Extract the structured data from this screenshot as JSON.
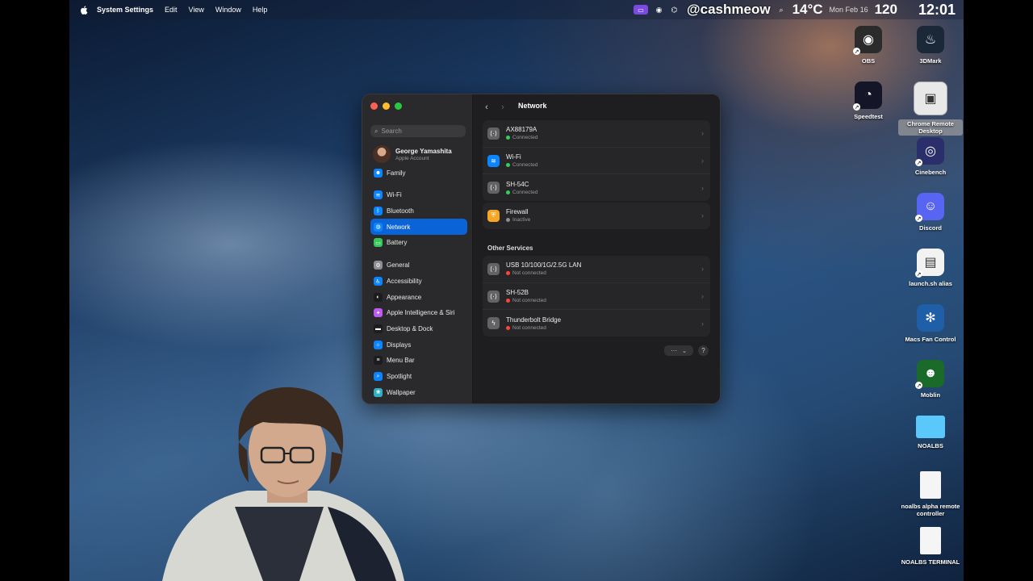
{
  "menubar": {
    "app_name": "System Settings",
    "menus": [
      "Edit",
      "View",
      "Window",
      "Help"
    ],
    "status": {
      "handle": "@cashmeow",
      "temperature": "14°C",
      "date": "Mon Feb 16",
      "overlay_number": "120",
      "clock": "12:01"
    }
  },
  "sidebar": {
    "search_placeholder": "Search",
    "account_name": "George Yamashita",
    "account_sub": "Apple Account",
    "family_label": "Family",
    "group1": [
      {
        "label": "Wi-Fi",
        "icon": "wifi-icon",
        "color": "#0a84ff",
        "glyph": "≋"
      },
      {
        "label": "Bluetooth",
        "icon": "bluetooth-icon",
        "color": "#0a84ff",
        "glyph": "ᛒ"
      },
      {
        "label": "Network",
        "icon": "globe-icon",
        "color": "#0a84ff",
        "glyph": "◍",
        "active": true
      },
      {
        "label": "Battery",
        "icon": "battery-icon",
        "color": "#34c759",
        "glyph": "▭"
      }
    ],
    "group2": [
      {
        "label": "General",
        "icon": "gear-icon",
        "color": "#8e8e93",
        "glyph": "⚙"
      },
      {
        "label": "Accessibility",
        "icon": "accessibility-icon",
        "color": "#0a84ff",
        "glyph": "♿"
      },
      {
        "label": "Appearance",
        "icon": "appearance-icon",
        "color": "#1c1c1e",
        "glyph": "◐"
      },
      {
        "label": "Apple Intelligence & Siri",
        "icon": "siri-icon",
        "color": "#bf5af2",
        "glyph": "✦"
      },
      {
        "label": "Desktop & Dock",
        "icon": "dock-icon",
        "color": "#1c1c1e",
        "glyph": "▬"
      },
      {
        "label": "Displays",
        "icon": "display-icon",
        "color": "#0a84ff",
        "glyph": "☼"
      },
      {
        "label": "Menu Bar",
        "icon": "menubar-icon",
        "color": "#1c1c1e",
        "glyph": "≡"
      },
      {
        "label": "Spotlight",
        "icon": "spotlight-icon",
        "color": "#0a84ff",
        "glyph": "⌕"
      },
      {
        "label": "Wallpaper",
        "icon": "wallpaper-icon",
        "color": "#30b0c7",
        "glyph": "❀"
      }
    ]
  },
  "main": {
    "title": "Network",
    "services": [
      {
        "name": "AX88179A",
        "status": "Connected",
        "status_color": "#30d158",
        "icon": "ethernet-icon",
        "icon_color": "#636366",
        "glyph": "⟨·⟩"
      },
      {
        "name": "Wi-Fi",
        "status": "Connected",
        "status_color": "#30d158",
        "icon": "wifi-icon",
        "icon_color": "#0a84ff",
        "glyph": "≋"
      },
      {
        "name": "SH-54C",
        "status": "Connected",
        "status_color": "#30d158",
        "icon": "ethernet-icon",
        "icon_color": "#636366",
        "glyph": "⟨·⟩"
      }
    ],
    "firewall": {
      "name": "Firewall",
      "status": "Inactive",
      "status_color": "#8e8e93",
      "icon": "firewall-icon",
      "icon_color": "#f5a623",
      "glyph": "⛨"
    },
    "other_services_label": "Other Services",
    "other_services": [
      {
        "name": "USB 10/100/1G/2.5G LAN",
        "status": "Not connected",
        "status_color": "#ff453a",
        "icon": "ethernet-icon",
        "icon_color": "#636366",
        "glyph": "⟨·⟩"
      },
      {
        "name": "SH-52B",
        "status": "Not connected",
        "status_color": "#ff453a",
        "icon": "ethernet-icon",
        "icon_color": "#636366",
        "glyph": "⟨·⟩"
      },
      {
        "name": "Thunderbolt Bridge",
        "status": "Not connected",
        "status_color": "#ff453a",
        "icon": "thunderbolt-icon",
        "icon_color": "#636366",
        "glyph": "ϟ"
      }
    ],
    "more_label": "···",
    "help_label": "?"
  },
  "desktop_icons": [
    {
      "label": "OBS",
      "icon": "obs-icon",
      "color": "#2b2b2b",
      "glyph": "◉",
      "alias": true
    },
    {
      "label": "3DMark",
      "icon": "steam-icon",
      "color": "#1b2838",
      "glyph": "♨",
      "alias": false
    },
    {
      "label": "Speedtest",
      "icon": "speedtest-icon",
      "color": "#141526",
      "glyph": "◔",
      "alias": true
    },
    {
      "label": "Chrome Remote Desktop",
      "icon": "chrome-remote-desktop-icon",
      "color": "#e8e8e8",
      "glyph": "▣",
      "alias": false,
      "selected": true
    },
    {
      "label": "Cinebench",
      "icon": "cinebench-icon",
      "color": "#2a2f6b",
      "glyph": "◎",
      "alias": true
    },
    {
      "label": "Discord",
      "icon": "discord-icon",
      "color": "#5865f2",
      "glyph": "☺",
      "alias": true
    },
    {
      "label": "launch.sh alias",
      "icon": "script-file-icon",
      "color": "#f2f2f2",
      "glyph": "▤",
      "alias": true
    },
    {
      "label": "Macs Fan Control",
      "icon": "fan-icon",
      "color": "#1e5fa8",
      "glyph": "✻",
      "alias": false
    },
    {
      "label": "Moblin",
      "icon": "moblin-icon",
      "color": "#1a6b2a",
      "glyph": "☻",
      "alias": true
    },
    {
      "label": "NOALBS",
      "icon": "folder-icon",
      "color": "#5ac8fa",
      "glyph": "",
      "alias": false
    },
    {
      "label": "noalbs alpha remote controller",
      "icon": "document-icon",
      "color": "#f5f5f5",
      "glyph": "",
      "alias": false
    },
    {
      "label": "NOALBS TERMINAL",
      "icon": "document-icon",
      "color": "#f5f5f5",
      "glyph": "",
      "alias": false
    }
  ]
}
